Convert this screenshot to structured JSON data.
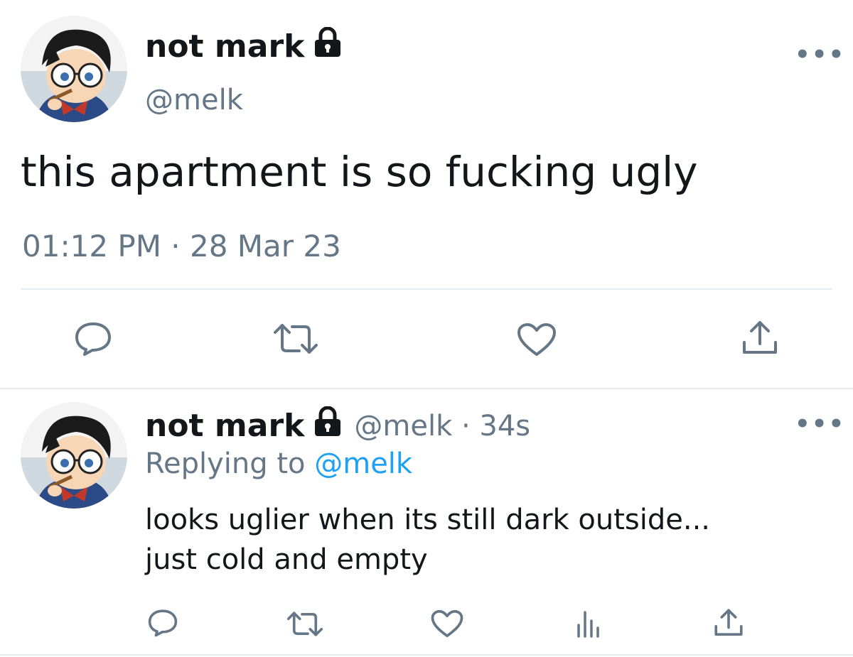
{
  "main_tweet": {
    "display_name": "not mark",
    "handle": "@melk",
    "text": "this apartment is so fucking ugly",
    "timestamp": "01:12 PM · 28 Mar 23",
    "more_label": "•••",
    "actions": [
      "reply-icon",
      "retweet-icon",
      "like-icon",
      "share-icon"
    ]
  },
  "reply_tweet": {
    "display_name": "not mark",
    "handle_and_time": "@melk · 34s",
    "replying_prefix": "Replying to",
    "replying_handle": "@melk",
    "text_line1": "looks uglier when its still dark outside...",
    "text_line2": "just cold and empty",
    "more_label": "•••",
    "actions": [
      "reply-icon",
      "retweet-icon",
      "like-icon",
      "analytics-icon",
      "share-icon"
    ]
  },
  "colors": {
    "text": "#14171a",
    "muted": "#657786",
    "link": "#1da1f2",
    "divider": "#e6ecf0"
  }
}
